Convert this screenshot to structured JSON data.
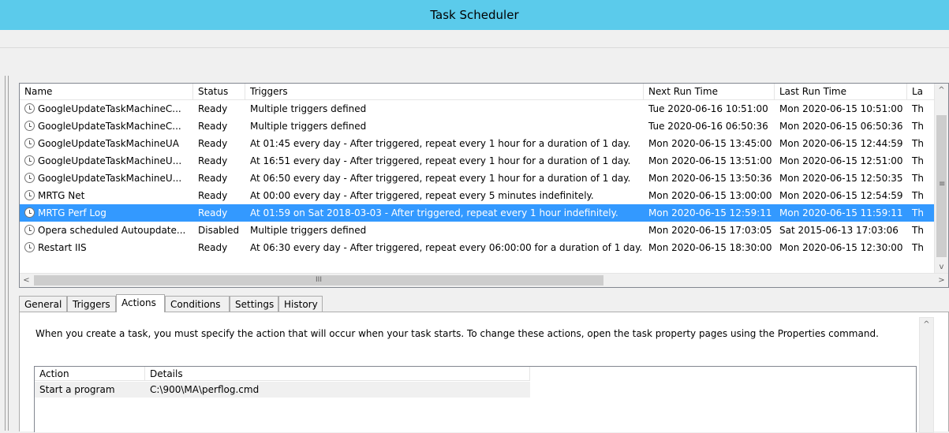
{
  "window": {
    "title": "Task Scheduler"
  },
  "task_list": {
    "columns": [
      "Name",
      "Status",
      "Triggers",
      "Next Run Time",
      "Last Run Time",
      "La"
    ],
    "rows": [
      {
        "name": "GoogleUpdateTaskMachineC...",
        "status": "Ready",
        "triggers": "Multiple triggers defined",
        "next": "Tue 2020-06-16 10:51:00",
        "last": "Mon 2020-06-15 10:51:00",
        "la": "Th"
      },
      {
        "name": "GoogleUpdateTaskMachineC...",
        "status": "Ready",
        "triggers": "Multiple triggers defined",
        "next": "Tue 2020-06-16 06:50:36",
        "last": "Mon 2020-06-15 06:50:36",
        "la": "Th"
      },
      {
        "name": "GoogleUpdateTaskMachineUA",
        "status": "Ready",
        "triggers": "At 01:45 every day - After triggered, repeat every 1 hour for a duration of 1 day.",
        "next": "Mon 2020-06-15 13:45:00",
        "last": "Mon 2020-06-15 12:44:59",
        "la": "Th"
      },
      {
        "name": "GoogleUpdateTaskMachineU...",
        "status": "Ready",
        "triggers": "At 16:51 every day - After triggered, repeat every 1 hour for a duration of 1 day.",
        "next": "Mon 2020-06-15 13:51:00",
        "last": "Mon 2020-06-15 12:51:00",
        "la": "Th"
      },
      {
        "name": "GoogleUpdateTaskMachineU...",
        "status": "Ready",
        "triggers": "At 06:50 every day - After triggered, repeat every 1 hour for a duration of 1 day.",
        "next": "Mon 2020-06-15 13:50:36",
        "last": "Mon 2020-06-15 12:50:35",
        "la": "Th"
      },
      {
        "name": "MRTG Net",
        "status": "Ready",
        "triggers": "At 00:00 every day - After triggered, repeat every 5 minutes indefinitely.",
        "next": "Mon 2020-06-15 13:00:00",
        "last": "Mon 2020-06-15 12:54:59",
        "la": "Th"
      },
      {
        "name": "MRTG Perf Log",
        "status": "Ready",
        "triggers": "At 01:59 on Sat 2018-03-03 - After triggered, repeat every 1 hour indefinitely.",
        "next": "Mon 2020-06-15 12:59:11",
        "last": "Mon 2020-06-15 11:59:11",
        "la": "Th"
      },
      {
        "name": "Opera scheduled Autoupdate...",
        "status": "Disabled",
        "triggers": "Multiple triggers defined",
        "next": "Mon 2020-06-15 17:03:05",
        "last": "Sat 2015-06-13 17:03:06",
        "la": "Th"
      },
      {
        "name": "Restart IIS",
        "status": "Ready",
        "triggers": "At 06:30 every day - After triggered, repeat every 06:00:00 for a duration of 1 day.",
        "next": "Mon 2020-06-15 18:30:00",
        "last": "Mon 2020-06-15 12:30:00",
        "la": "Th"
      }
    ],
    "selected_index": 6,
    "scroll_up": "^",
    "scroll_down": "v",
    "scroll_left": "<",
    "scroll_right": ">",
    "scroll_grip": "III",
    "vscroll_grip": "≡"
  },
  "tabs": [
    "General",
    "Triggers",
    "Actions",
    "Conditions",
    "Settings",
    "History"
  ],
  "active_tab": "Actions",
  "actions_panel": {
    "description": "When you create a task, you must specify the action that will occur when your task starts.  To change these actions, open the task property pages using the Properties command.",
    "columns": [
      "Action",
      "Details"
    ],
    "rows": [
      {
        "action": "Start a program",
        "details": "C:\\900\\MA\\perflog.cmd"
      }
    ],
    "scroll_up": "^"
  }
}
